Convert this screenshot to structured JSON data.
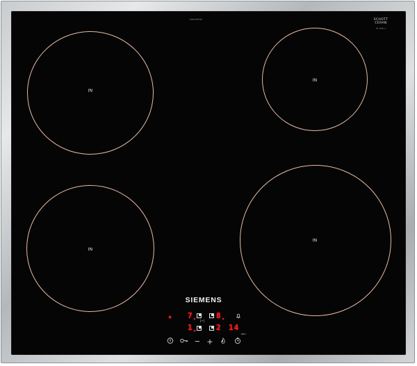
{
  "hob": {
    "brand": "SIEMENS",
    "model_number": "EU6430EF1E",
    "glass_brand_line1": "SCHOTT",
    "glass_brand_line2": "CERAN",
    "glass_brand_sub": "MF 3016-4",
    "zones": [
      {
        "name": "zone-rear-left",
        "label": "IN"
      },
      {
        "name": "zone-rear-right",
        "label": "IN"
      },
      {
        "name": "zone-front-left",
        "label": "IN"
      },
      {
        "name": "zone-front-right",
        "label": "IN"
      }
    ],
    "display": {
      "top_left_digit": "7",
      "top_right_digit": "8",
      "bottom_left_digit": "1",
      "bottom_mid_digit": "2",
      "timer": "14",
      "timer_unit": "min",
      "colors": {
        "glass": "#050506",
        "zone_outline": "#e8bca4",
        "led": "#ff1e1e"
      }
    },
    "controls": {
      "power_icon": "power-icon",
      "key_lock_icon": "key-lock-icon",
      "minus_icon": "minus-icon",
      "plus_icon": "plus-icon",
      "boost_icon": "boost-icon",
      "timer_icon": "timer-icon",
      "bell_icon": "bell-icon",
      "minus": "−",
      "plus": "+"
    }
  }
}
